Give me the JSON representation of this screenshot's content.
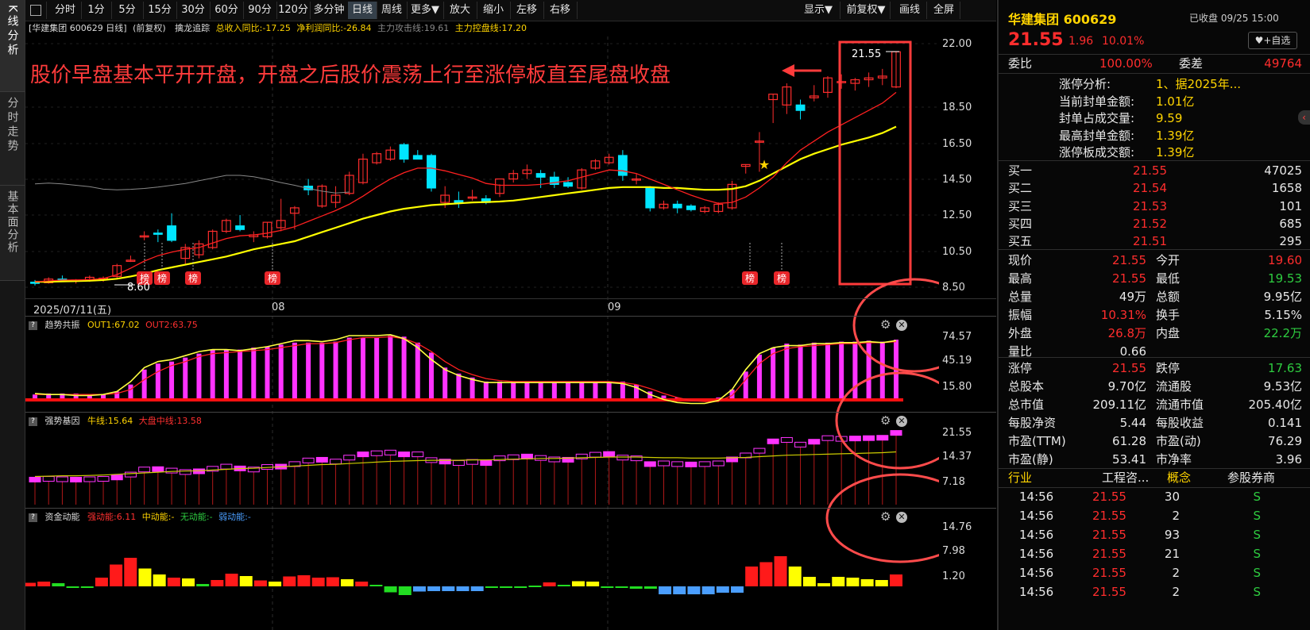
{
  "sidebar": {
    "tabs": [
      "K线分析",
      "分时走势",
      "基本面分析"
    ]
  },
  "toolbar": {
    "buttons": [
      "分时",
      "1分",
      "5分",
      "15分",
      "30分",
      "60分",
      "90分",
      "120分",
      "多分钟",
      "日线",
      "周线",
      "更多▼",
      "放大",
      "缩小",
      "左移",
      "右移"
    ],
    "active": "日线",
    "right_buttons": [
      "显示▼",
      "前复权▼",
      "画线",
      "全屏"
    ]
  },
  "info": {
    "stock": "[华建集团 600629 日线]",
    "fq": "(前复权)",
    "indicator": "擒龙追踪",
    "rev_label": "总收入同比:",
    "rev_value": "-17.25",
    "profit_label": "净利润同比:",
    "profit_value": "-26.84",
    "attack_label": "主力攻击线:",
    "attack_value": "19.61",
    "control_label": "主力控盘线:",
    "control_value": "17.20"
  },
  "annotation": {
    "text": "股价早盘基本平开开盘，开盘之后股价震荡上行至涨停板直至尾盘收盘",
    "max_label": "21.55",
    "min_label": "8.60"
  },
  "price_axis": [
    "22.00",
    "18.50",
    "16.50",
    "14.50",
    "12.50",
    "10.50",
    "8.50"
  ],
  "dates": {
    "start": "2025/07/11(五)",
    "m08": "08",
    "m09": "09"
  },
  "bang": "榜",
  "panel1": {
    "name": "趋势共振",
    "out1_label": "OUT1:",
    "out1": "67.02",
    "out2_label": "OUT2:",
    "out2": "63.75",
    "axis": [
      "74.57",
      "45.19",
      "15.80"
    ]
  },
  "panel2": {
    "name": "强势基因",
    "l1_label": "牛线:",
    "l1": "15.64",
    "l2_label": "大盘中线:",
    "l2": "13.58",
    "axis": [
      "21.55",
      "14.37",
      "7.18"
    ]
  },
  "panel3": {
    "name": "资金动能",
    "a_label": "强动能:",
    "a": "6.11",
    "b_label": "中动能:",
    "b": "-",
    "c_label": "无动能:",
    "c": "-",
    "d_label": "弱动能:",
    "d": "-",
    "axis": [
      "14.76",
      "7.98",
      "1.20"
    ]
  },
  "quote": {
    "name": "华建集团",
    "code": "600629",
    "status": "已收盘 09/25 15:00",
    "price": "21.55",
    "change": "1.96",
    "pct": "10.01%",
    "follow": "+自选",
    "wb_label": "委比",
    "wb": "100.00%",
    "wc_label": "委差",
    "wc": "49764",
    "zt": [
      {
        "label": "涨停分析:",
        "value": "1、据2025年..."
      },
      {
        "label": "当前封单金额:",
        "value": "1.01亿"
      },
      {
        "label": "封单占成交量:",
        "value": "9.59"
      },
      {
        "label": "最高封单金额:",
        "value": "1.39亿"
      },
      {
        "label": "涨停板成交额:",
        "value": "1.39亿"
      }
    ],
    "buy": [
      {
        "label": "买一",
        "price": "21.55",
        "vol": "47025"
      },
      {
        "label": "买二",
        "price": "21.54",
        "vol": "1658"
      },
      {
        "label": "买三",
        "price": "21.53",
        "vol": "101"
      },
      {
        "label": "买四",
        "price": "21.52",
        "vol": "685"
      },
      {
        "label": "买五",
        "price": "21.51",
        "vol": "295"
      }
    ],
    "stats": [
      {
        "l1": "现价",
        "v1": "21.55",
        "c1": "red",
        "l2": "今开",
        "v2": "19.60",
        "c2": "red"
      },
      {
        "l1": "最高",
        "v1": "21.55",
        "c1": "red",
        "l2": "最低",
        "v2": "19.53",
        "c2": "green"
      },
      {
        "l1": "总量",
        "v1": "49万",
        "c1": "white",
        "l2": "总额",
        "v2": "9.95亿",
        "c2": "white"
      },
      {
        "l1": "振幅",
        "v1": "10.31%",
        "c1": "red",
        "l2": "换手",
        "v2": "5.15%",
        "c2": "white"
      },
      {
        "l1": "外盘",
        "v1": "26.8万",
        "c1": "red",
        "l2": "内盘",
        "v2": "22.2万",
        "c2": "green"
      },
      {
        "l1": "量比",
        "v1": "0.66",
        "c1": "white",
        "l2": "",
        "v2": "",
        "c2": "white"
      },
      {
        "l1": "涨停",
        "v1": "21.55",
        "c1": "red",
        "l2": "跌停",
        "v2": "17.63",
        "c2": "green"
      },
      {
        "l1": "总股本",
        "v1": "9.70亿",
        "c1": "white",
        "l2": "流通股",
        "v2": "9.53亿",
        "c2": "white"
      },
      {
        "l1": "总市值",
        "v1": "209.11亿",
        "c1": "white",
        "l2": "流通市值",
        "v2": "205.40亿",
        "c2": "white"
      },
      {
        "l1": "每股净资",
        "v1": "5.44",
        "c1": "white",
        "l2": "每股收益",
        "v2": "0.141",
        "c2": "white"
      },
      {
        "l1": "市盈(TTM)",
        "v1": "61.28",
        "c1": "white",
        "l2": "市盈(动)",
        "v2": "76.29",
        "c2": "white"
      },
      {
        "l1": "市盈(静)",
        "v1": "53.41",
        "c1": "white",
        "l2": "市净率",
        "v2": "3.96",
        "c2": "white"
      }
    ],
    "tabs": [
      "行业",
      "工程咨...",
      "概念",
      "参股券商"
    ],
    "trades": [
      {
        "t": "14:56",
        "p": "21.55",
        "v": "30",
        "d": "S"
      },
      {
        "t": "14:56",
        "p": "21.55",
        "v": "2",
        "d": "S"
      },
      {
        "t": "14:56",
        "p": "21.55",
        "v": "93",
        "d": "S"
      },
      {
        "t": "14:56",
        "p": "21.55",
        "v": "21",
        "d": "S"
      },
      {
        "t": "14:56",
        "p": "21.55",
        "v": "2",
        "d": "S"
      },
      {
        "t": "14:56",
        "p": "21.55",
        "v": "2",
        "d": "S"
      }
    ]
  },
  "colors": {
    "up": "#ff2d2d",
    "down": "#00e5ff",
    "ma_short": "#ff2020",
    "ma_long": "#ffff00",
    "ma_gray": "#888888",
    "mag": "#ff33ff",
    "annot": "#ff3b3b"
  },
  "chart_data": [
    {
      "type": "candlestick",
      "title": "华建集团 600629 日线",
      "ohlc": [
        [
          8.78,
          8.9,
          8.6,
          8.75
        ],
        [
          8.75,
          9.05,
          8.7,
          8.95
        ],
        [
          8.95,
          9.15,
          8.8,
          8.85
        ],
        [
          8.85,
          8.95,
          8.7,
          8.9
        ],
        [
          8.9,
          9.15,
          8.8,
          9.05
        ],
        [
          9.0,
          9.1,
          8.8,
          9.0
        ],
        [
          9.1,
          9.8,
          9.0,
          9.7
        ],
        [
          10.0,
          10.25,
          9.9,
          10.0
        ],
        [
          11.3,
          11.6,
          11.1,
          11.35
        ],
        [
          11.5,
          11.7,
          11.0,
          11.45
        ],
        [
          11.9,
          12.6,
          11.0,
          11.1
        ],
        [
          10.1,
          10.9,
          9.8,
          10.7
        ],
        [
          10.3,
          11.1,
          10.1,
          10.9
        ],
        [
          10.7,
          11.7,
          10.6,
          11.6
        ],
        [
          11.6,
          12.3,
          11.5,
          12.2
        ],
        [
          11.9,
          12.5,
          11.6,
          11.7
        ],
        [
          11.3,
          11.6,
          11.0,
          11.4
        ],
        [
          11.3,
          12.1,
          11.2,
          12.1
        ],
        [
          11.8,
          13.4,
          11.6,
          12.2
        ],
        [
          12.6,
          13.0,
          11.7,
          12.9
        ],
        [
          14.1,
          14.5,
          13.6,
          13.9
        ],
        [
          13.0,
          14.2,
          12.9,
          14.1
        ],
        [
          13.2,
          14.1,
          12.9,
          13.6
        ],
        [
          13.7,
          14.9,
          13.6,
          14.7
        ],
        [
          14.3,
          15.9,
          14.2,
          15.6
        ],
        [
          15.4,
          16.0,
          15.3,
          15.9
        ],
        [
          15.6,
          16.3,
          15.5,
          16.1
        ],
        [
          16.4,
          16.5,
          15.4,
          15.6
        ],
        [
          15.8,
          16.1,
          15.6,
          15.6
        ],
        [
          15.8,
          15.9,
          13.8,
          14.0
        ],
        [
          13.2,
          14.1,
          12.9,
          13.6
        ],
        [
          13.3,
          13.8,
          12.9,
          13.2
        ],
        [
          13.5,
          13.9,
          13.3,
          13.5
        ],
        [
          13.4,
          13.6,
          13.1,
          13.2
        ],
        [
          13.7,
          14.2,
          13.5,
          14.5
        ],
        [
          14.5,
          15.0,
          14.3,
          14.8
        ],
        [
          14.8,
          15.3,
          14.5,
          15.0
        ],
        [
          14.8,
          15.0,
          14.0,
          14.6
        ],
        [
          14.6,
          14.9,
          14.0,
          14.2
        ],
        [
          14.3,
          14.6,
          14.0,
          14.1
        ],
        [
          14.0,
          15.1,
          13.9,
          15.0
        ],
        [
          15.1,
          15.6,
          15.0,
          15.5
        ],
        [
          15.4,
          15.9,
          15.3,
          15.7
        ],
        [
          15.8,
          16.1,
          14.4,
          14.7
        ],
        [
          14.5,
          14.8,
          14.2,
          14.5
        ],
        [
          14.0,
          14.1,
          12.7,
          12.9
        ],
        [
          12.9,
          13.3,
          12.8,
          13.1
        ],
        [
          13.1,
          13.3,
          12.6,
          12.9
        ],
        [
          13.0,
          13.1,
          12.7,
          12.8
        ],
        [
          12.7,
          13.0,
          12.6,
          12.9
        ],
        [
          12.7,
          13.2,
          12.6,
          13.1
        ],
        [
          12.9,
          14.4,
          12.8,
          14.2
        ],
        [
          15.2,
          15.3,
          14.8,
          15.3
        ],
        [
          16.6,
          17.1,
          14.9,
          16.6
        ],
        [
          18.9,
          19.2,
          17.6,
          19.2
        ],
        [
          18.6,
          19.8,
          18.1,
          19.6
        ],
        [
          18.6,
          18.9,
          17.8,
          18.3
        ],
        [
          19.0,
          19.7,
          18.8,
          19.1
        ],
        [
          19.3,
          20.2,
          19.0,
          20.1
        ],
        [
          19.9,
          20.3,
          19.5,
          19.9
        ],
        [
          19.8,
          20.1,
          19.4,
          20.0
        ],
        [
          20.0,
          20.4,
          19.6,
          20.1
        ],
        [
          20.1,
          20.6,
          19.7,
          20.2
        ],
        [
          19.6,
          21.55,
          19.53,
          21.55
        ]
      ],
      "ma_short": [
        8.8,
        8.85,
        8.9,
        8.9,
        8.92,
        8.98,
        9.2,
        9.55,
        9.95,
        10.25,
        10.45,
        10.6,
        10.7,
        10.95,
        11.2,
        11.35,
        11.4,
        11.5,
        11.65,
        11.85,
        12.15,
        12.45,
        12.75,
        13.1,
        13.55,
        14.05,
        14.5,
        14.85,
        15.1,
        15.1,
        14.95,
        14.75,
        14.55,
        14.25,
        14.15,
        14.15,
        14.15,
        14.2,
        14.3,
        14.4,
        14.6,
        14.8,
        15.0,
        14.95,
        14.8,
        14.5,
        14.2,
        13.9,
        13.6,
        13.35,
        13.15,
        13.2,
        13.5,
        14.0,
        14.6,
        15.4,
        16.1,
        16.6,
        17.1,
        17.5,
        17.9,
        18.3,
        18.7,
        19.3
      ],
      "ma_long": [
        8.8,
        8.8,
        8.82,
        8.84,
        8.86,
        8.9,
        8.97,
        9.1,
        9.25,
        9.45,
        9.6,
        9.75,
        9.9,
        10.05,
        10.2,
        10.4,
        10.6,
        10.75,
        10.9,
        11.05,
        11.3,
        11.55,
        11.8,
        12.05,
        12.3,
        12.5,
        12.7,
        12.85,
        12.95,
        13.05,
        13.1,
        13.15,
        13.2,
        13.22,
        13.25,
        13.3,
        13.4,
        13.5,
        13.6,
        13.7,
        13.8,
        13.9,
        14.0,
        14.05,
        14.05,
        14.05,
        14.0,
        14.0,
        13.95,
        13.9,
        13.9,
        13.95,
        14.1,
        14.4,
        14.8,
        15.2,
        15.6,
        15.9,
        16.15,
        16.4,
        16.6,
        16.8,
        17.05,
        17.4
      ],
      "ylim": [
        8.5,
        22.0
      ]
    },
    {
      "type": "bar",
      "title": "趋势共振",
      "values": [
        15,
        16,
        16,
        16,
        15,
        15,
        18,
        25,
        40,
        46,
        48,
        52,
        56,
        60,
        60,
        60,
        62,
        63,
        65,
        67,
        67,
        67,
        68,
        72,
        72,
        72,
        74,
        73,
        67,
        57,
        42,
        36,
        32,
        28,
        28,
        28,
        28,
        28,
        28,
        28,
        28,
        28,
        28,
        28,
        25,
        18,
        14,
        12,
        11,
        11,
        12,
        20,
        38,
        55,
        62,
        66,
        65,
        67,
        67,
        68,
        68,
        69,
        68,
        70
      ],
      "out1": [
        16,
        15,
        15,
        14,
        14,
        15,
        18,
        28,
        42,
        48,
        50,
        54,
        58,
        60,
        60,
        59,
        61,
        63,
        66,
        69,
        69,
        68,
        70,
        74,
        74,
        74,
        75,
        71,
        62,
        50,
        40,
        34,
        30,
        27,
        27,
        27,
        27,
        27,
        27,
        27,
        27,
        27,
        27,
        26,
        22,
        15,
        10,
        7,
        6,
        6,
        9,
        20,
        40,
        56,
        62,
        64,
        64,
        66,
        66,
        67,
        67,
        68,
        67,
        69
      ],
      "out2": [
        15,
        15,
        15,
        15,
        15,
        15,
        16,
        20,
        30,
        38,
        44,
        48,
        53,
        56,
        57,
        58,
        59,
        60,
        62,
        64,
        66,
        66,
        67,
        70,
        72,
        72,
        73,
        71,
        66,
        58,
        48,
        40,
        35,
        31,
        29,
        28,
        28,
        28,
        28,
        28,
        28,
        28,
        28,
        27,
        25,
        21,
        16,
        12,
        9,
        8,
        8,
        14,
        30,
        46,
        56,
        61,
        63,
        64,
        65,
        66,
        66,
        67,
        67,
        68
      ],
      "ylim": [
        8,
        78
      ]
    },
    {
      "type": "bar",
      "title": "强势基因",
      "boxes": [
        8.6,
        8.8,
        8.7,
        8.6,
        8.7,
        8.8,
        9.2,
        10.0,
        11.4,
        11.5,
        11.1,
        10.7,
        10.9,
        11.6,
        12.2,
        11.7,
        11.4,
        12.1,
        12.2,
        12.9,
        13.9,
        14.1,
        13.6,
        14.7,
        15.6,
        15.9,
        16.1,
        15.6,
        15.6,
        14.0,
        13.6,
        13.2,
        13.5,
        13.2,
        14.5,
        14.8,
        15.0,
        14.6,
        14.2,
        14.1,
        15.0,
        15.5,
        15.7,
        14.7,
        14.5,
        12.9,
        13.1,
        12.9,
        12.8,
        12.9,
        13.1,
        14.2,
        15.3,
        16.6,
        19.2,
        19.6,
        18.3,
        19.1,
        20.1,
        19.9,
        20.0,
        20.1,
        20.2,
        21.55
      ],
      "line1": [
        8.8,
        8.9,
        9.0,
        9.0,
        9.1,
        9.2,
        9.4,
        9.6,
        9.8,
        10.0,
        10.2,
        10.3,
        10.4,
        10.6,
        10.8,
        11.0,
        11.1,
        11.3,
        11.5,
        11.7,
        11.9,
        12.1,
        12.2,
        12.4,
        12.6,
        12.8,
        13.0,
        13.1,
        13.2,
        13.3,
        13.3,
        13.3,
        13.4,
        13.4,
        13.5,
        13.6,
        13.7,
        13.8,
        13.8,
        13.9,
        14.0,
        14.1,
        14.2,
        14.2,
        14.2,
        14.1,
        14.0,
        14.0,
        13.9,
        13.9,
        13.9,
        14.0,
        14.1,
        14.3,
        14.5,
        14.7,
        14.8,
        14.9,
        15.0,
        15.1,
        15.2,
        15.3,
        15.4,
        15.64
      ],
      "ylim": [
        1,
        23
      ]
    },
    {
      "type": "bar",
      "title": "资金动能",
      "values": [
        0.9,
        1.2,
        0.8,
        -0.2,
        -0.3,
        2.2,
        5.5,
        7.2,
        4.5,
        3.0,
        2.2,
        2.0,
        0.6,
        1.6,
        3.2,
        2.6,
        1.5,
        1.2,
        2.5,
        2.8,
        2.2,
        2.3,
        1.8,
        1.2,
        0.4,
        -1.5,
        -2.2,
        -1.3,
        -1.2,
        -1.2,
        -1.2,
        -1.2,
        -0.4,
        -0.2,
        -0.1,
        0.2,
        1.0,
        0.4,
        1.3,
        1.2,
        -0.4,
        -0.4,
        -0.6,
        -0.6,
        -2.0,
        -2.0,
        -2.0,
        -2.0,
        -1.6,
        -1.6,
        5.0,
        6.1,
        7.6,
        5.0,
        2.4,
        0.8,
        2.4,
        2.2,
        1.8,
        1.6,
        3.0
      ],
      "colors": [
        "r",
        "r",
        "g",
        "g",
        "g",
        "r",
        "r",
        "r",
        "y",
        "y",
        "r",
        "y",
        "g",
        "r",
        "r",
        "y",
        "r",
        "y",
        "r",
        "r",
        "r",
        "r",
        "y",
        "r",
        "g",
        "g",
        "g",
        "b",
        "b",
        "b",
        "b",
        "b",
        "g",
        "g",
        "g",
        "g",
        "r",
        "g",
        "y",
        "y",
        "g",
        "g",
        "g",
        "g",
        "b",
        "b",
        "b",
        "b",
        "b",
        "b",
        "r",
        "r",
        "r",
        "y",
        "y",
        "y",
        "y",
        "y",
        "y",
        "y",
        "r"
      ],
      "ylim": [
        -3,
        16
      ]
    }
  ]
}
